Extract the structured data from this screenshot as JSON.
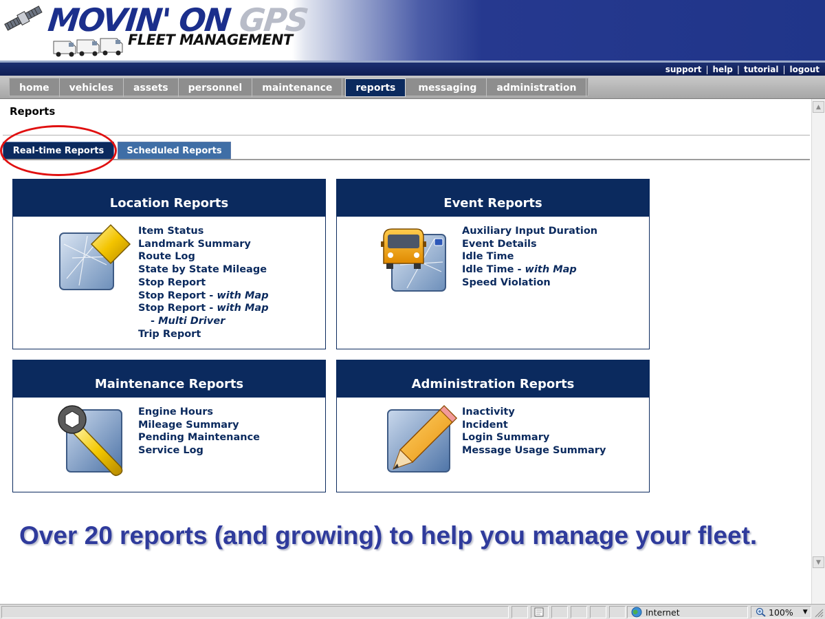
{
  "brand": {
    "name_part1": "MOVIN' ON ",
    "name_part2": "GPS",
    "tagline": "FLEET MANAGEMENT"
  },
  "utility_links": [
    "support",
    "help",
    "tutorial",
    "logout"
  ],
  "nav": {
    "items": [
      {
        "label": "home"
      },
      {
        "label": "vehicles"
      },
      {
        "label": "assets"
      },
      {
        "label": "personnel"
      },
      {
        "label": "maintenance"
      },
      {
        "label": "reports",
        "active": true
      },
      {
        "label": "messaging"
      },
      {
        "label": "administration"
      }
    ]
  },
  "page": {
    "title": "Reports",
    "tabs": [
      {
        "label": "Real-time Reports",
        "active": true
      },
      {
        "label": "Scheduled Reports"
      }
    ]
  },
  "panels": {
    "location": {
      "title": "Location Reports",
      "icon": "map-diamond-icon",
      "links": [
        "Item Status",
        "Landmark Summary",
        "Route Log",
        "State by State Mileage",
        "Stop Report"
      ],
      "with_map_a": {
        "prefix": "Stop Report - ",
        "em": "with Map"
      },
      "with_map_b": {
        "prefix": "Stop Report - ",
        "em": "with Map"
      },
      "multi_driver": {
        "prefix": "- ",
        "em": "Multi Driver"
      },
      "trip": "Trip Report"
    },
    "event": {
      "title": "Event Reports",
      "icon": "van-map-icon",
      "links": [
        "Auxiliary Input Duration",
        "Event Details",
        "Idle Time"
      ],
      "idle_map": {
        "prefix": "Idle Time - ",
        "em": "with Map"
      },
      "speed": "Speed Violation"
    },
    "maintenance": {
      "title": "Maintenance Reports",
      "icon": "wrench-icon",
      "links": [
        "Engine Hours",
        "Mileage Summary",
        "Pending Maintenance",
        "Service Log"
      ]
    },
    "administration": {
      "title": "Administration Reports",
      "icon": "pencil-icon",
      "links": [
        "Inactivity",
        "Incident",
        "Login Summary",
        "Message Usage Summary"
      ]
    }
  },
  "caption": "Over 20 reports (and growing) to help you manage your fleet.",
  "statusbar": {
    "zone": "Internet",
    "zoom": "100%"
  },
  "colors": {
    "navy": "#0b2a5e",
    "tab_inactive": "#3f6ea6",
    "highlight_circle": "#e01010",
    "caption": "#2f3b9c"
  }
}
